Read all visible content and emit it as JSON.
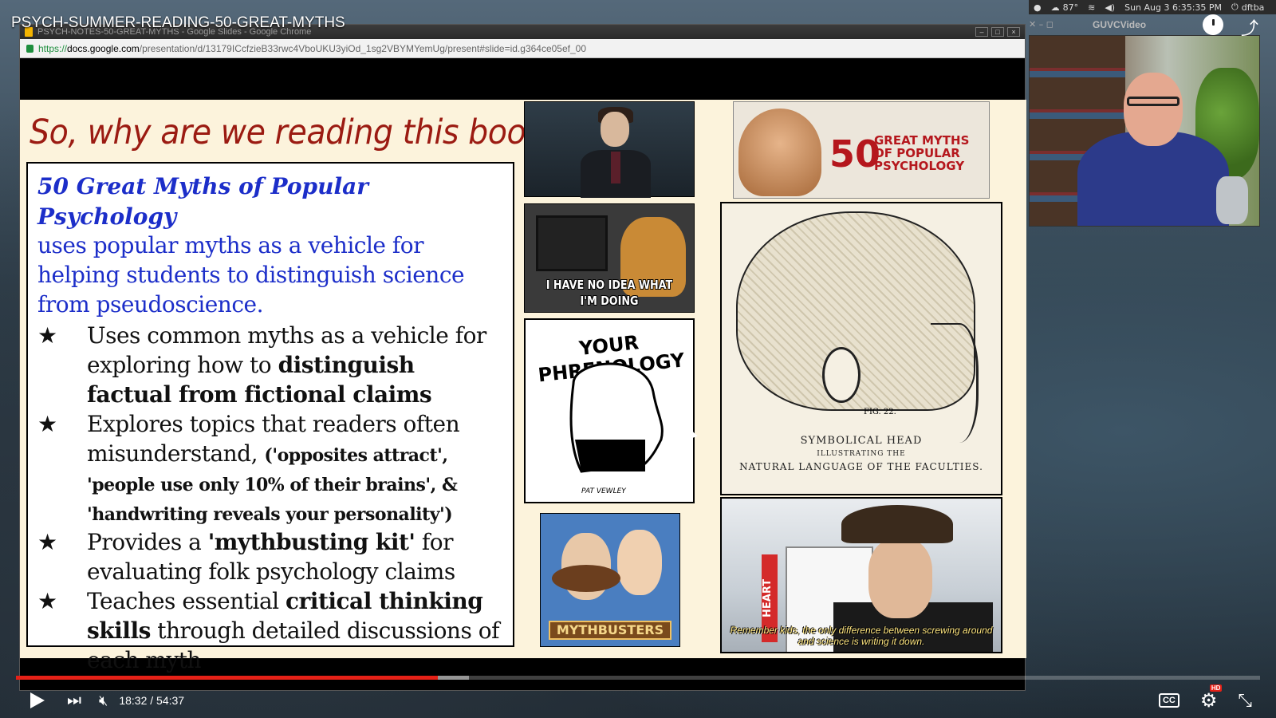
{
  "youtube": {
    "video_title": "PSYCH-SUMMER-READING-50-GREAT-MYTHS",
    "current_time": "18:32",
    "duration": "54:37",
    "time_display": "18:32 / 54:37",
    "played_fraction": 0.339,
    "buffered_fraction": 0.364,
    "cc_label": "CC",
    "hd_badge": "HD",
    "progress_color": "#e62117"
  },
  "system_tray": {
    "temperature": "87°",
    "datetime": "Sun Aug 3  6:35:35 PM",
    "user": "dftba"
  },
  "webcam_window": {
    "title": "GUVCVideo"
  },
  "browser": {
    "window_title": "PSYCH-NOTES-50-GREAT-MYTHS - Google Slides - Google Chrome",
    "url_scheme": "https://",
    "url_host": "docs.google.com",
    "url_path": "/presentation/d/13179ICcfzieB33rwc4VboUKU3yiOd_1sg2VBYMYemUg/present#slide=id.g364ce05ef_00"
  },
  "slide": {
    "heading": "So, why are we reading this book?",
    "heading_color": "#9b1b12",
    "book_title": "50 Great Myths of Popular Psychology",
    "intro": "uses popular myths as a vehicle for helping students to distinguish science from pseudoscience.",
    "accent_color": "#1c2ec9",
    "bullet_marker": "★",
    "bullets": [
      {
        "pre": "Uses common myths as a vehicle for exploring how to ",
        "bold": "distinguish factual from fictional claims"
      },
      {
        "pre": "Explores topics that readers often misunderstand, ",
        "small_pre": "(",
        "small_b1": "'opposites attract'",
        "small_sep1": ", ",
        "small_b2": "'people use only 10% of their brains'",
        "small_sep2": ", & ",
        "small_b3": "'handwriting reveals your personality'",
        "small_post": ")"
      },
      {
        "pre": "Provides a ",
        "bold": "'mythbusting kit'",
        "post": " for evaluating folk psychology claims"
      },
      {
        "pre": "Teaches essential ",
        "bold": "critical thinking skills",
        "post": " through detailed discussions of each myth"
      }
    ],
    "images": {
      "meme_caption": "I HAVE NO IDEA WHAT I'M DOING",
      "cartoon_title": "YOUR PHRENOLOGY",
      "cartoon_credit": "PAT VEWLEY",
      "mythbusters_logo": "MYTHBUSTERS",
      "book_number": "50",
      "book_title": "GREAT MYTHS OF POPULAR PSYCHOLOGY",
      "phren_fig": "FIG. 22.",
      "phren_caption_1": "SYMBOLICAL HEAD",
      "phren_caption_2": "ILLUSTRATING THE",
      "phren_caption_3": "NATURAL LANGUAGE OF THE FACULTIES.",
      "adam_heart": "HEART",
      "adam_subtitle": "Remember kids, the only difference between screwing around and science is writing it down."
    }
  }
}
